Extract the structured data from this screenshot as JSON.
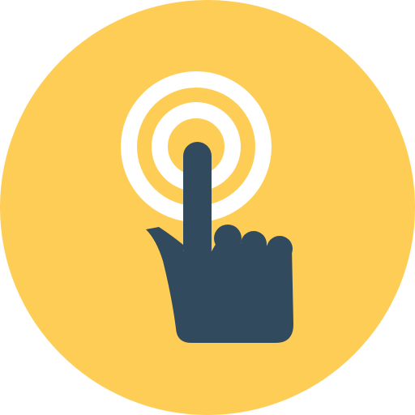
{
  "icon": {
    "name": "touch-tap-icon",
    "colors": {
      "badge": "#FDCD56",
      "hand": "#324A5E",
      "rings": "#FFFFFF"
    }
  }
}
